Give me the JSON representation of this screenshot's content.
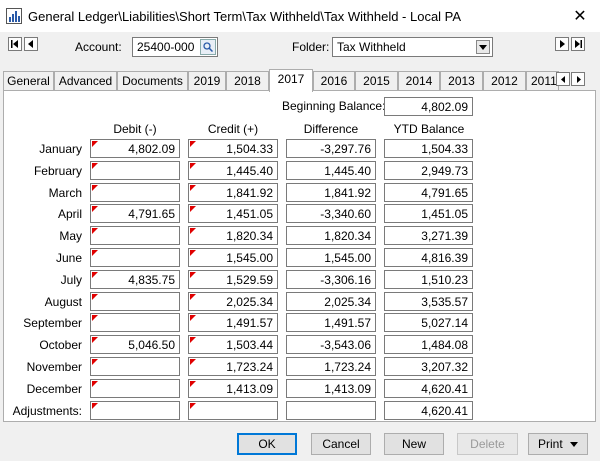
{
  "window": {
    "title": "General Ledger\\Liabilities\\Short Term\\Tax Withheld\\Tax Withheld - Local PA",
    "close": "✕"
  },
  "toolbar": {
    "account_label": "Account:",
    "account_value": "25400-000",
    "folder_label": "Folder:",
    "folder_value": "Tax Withheld"
  },
  "tabs": [
    "General",
    "Advanced",
    "Documents",
    "2019",
    "2018",
    "2017",
    "2016",
    "2015",
    "2014",
    "2013",
    "2012",
    "2011"
  ],
  "active_tab": "2017",
  "ledger": {
    "beginning_balance_label": "Beginning Balance:",
    "beginning_balance": "4,802.09",
    "columns": [
      "Debit (-)",
      "Credit (+)",
      "Difference",
      "YTD Balance"
    ],
    "rows": [
      {
        "month": "January",
        "debit": "4,802.09",
        "credit": "1,504.33",
        "difference": "-3,297.76",
        "ytd": "1,504.33"
      },
      {
        "month": "February",
        "debit": "",
        "credit": "1,445.40",
        "difference": "1,445.40",
        "ytd": "2,949.73"
      },
      {
        "month": "March",
        "debit": "",
        "credit": "1,841.92",
        "difference": "1,841.92",
        "ytd": "4,791.65"
      },
      {
        "month": "April",
        "debit": "4,791.65",
        "credit": "1,451.05",
        "difference": "-3,340.60",
        "ytd": "1,451.05"
      },
      {
        "month": "May",
        "debit": "",
        "credit": "1,820.34",
        "difference": "1,820.34",
        "ytd": "3,271.39"
      },
      {
        "month": "June",
        "debit": "",
        "credit": "1,545.00",
        "difference": "1,545.00",
        "ytd": "4,816.39"
      },
      {
        "month": "July",
        "debit": "4,835.75",
        "credit": "1,529.59",
        "difference": "-3,306.16",
        "ytd": "1,510.23"
      },
      {
        "month": "August",
        "debit": "",
        "credit": "2,025.34",
        "difference": "2,025.34",
        "ytd": "3,535.57"
      },
      {
        "month": "September",
        "debit": "",
        "credit": "1,491.57",
        "difference": "1,491.57",
        "ytd": "5,027.14"
      },
      {
        "month": "October",
        "debit": "5,046.50",
        "credit": "1,503.44",
        "difference": "-3,543.06",
        "ytd": "1,484.08"
      },
      {
        "month": "November",
        "debit": "",
        "credit": "1,723.24",
        "difference": "1,723.24",
        "ytd": "3,207.32"
      },
      {
        "month": "December",
        "debit": "",
        "credit": "1,413.09",
        "difference": "1,413.09",
        "ytd": "4,620.41"
      },
      {
        "month": "Adjustments:",
        "debit": "",
        "credit": "",
        "difference": "",
        "ytd": "4,620.41"
      }
    ]
  },
  "buttons": {
    "ok": "OK",
    "cancel": "Cancel",
    "new": "New",
    "delete": "Delete",
    "print": "Print"
  },
  "colors": {
    "flag": "#e00000",
    "focus": "#0078d7"
  }
}
